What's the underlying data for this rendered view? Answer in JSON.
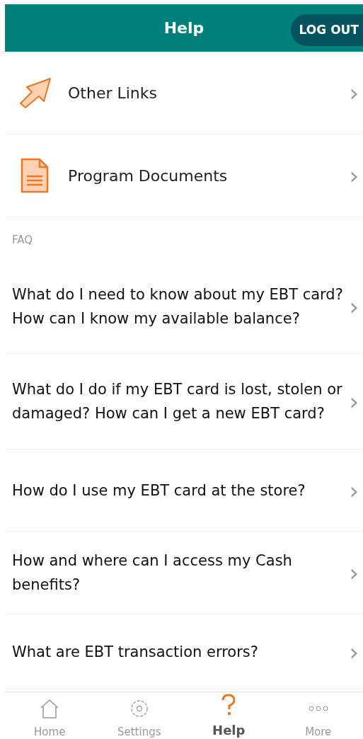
{
  "header": {
    "title": "Help",
    "logout": "LOG OUT"
  },
  "links": [
    {
      "label": "Other Links",
      "chevron": "›"
    },
    {
      "label": "Program Documents",
      "chevron": "›"
    }
  ],
  "faq": {
    "heading": "FAQ",
    "items": [
      {
        "question": "What do I need to know about my EBT card? How can I know my available balance?",
        "chevron": "›"
      },
      {
        "question": "What do I do if my EBT card is lost, stolen or damaged? How can I get a new EBT card?",
        "chevron": "›"
      },
      {
        "question": "How do I use my EBT card at the store?",
        "chevron": "›"
      },
      {
        "question": "How and where can I access my Cash benefits?",
        "chevron": "›"
      },
      {
        "question": "What are EBT transaction errors?",
        "chevron": "›"
      }
    ]
  },
  "tabs": [
    {
      "label": "Home",
      "selected": false
    },
    {
      "label": "Settings",
      "selected": false
    },
    {
      "label": "Help",
      "selected": true
    },
    {
      "label": "More",
      "selected": false
    }
  ]
}
